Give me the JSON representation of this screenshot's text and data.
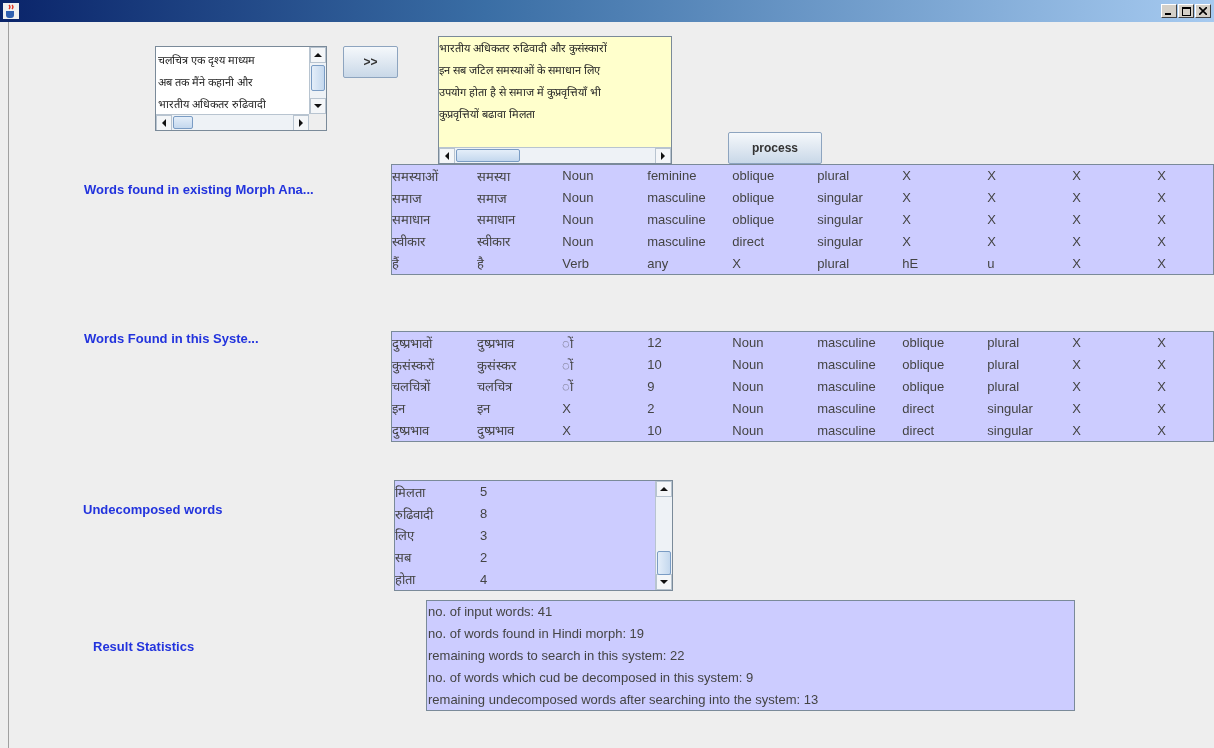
{
  "input_text": {
    "lines": [
      "चलचित्र एक दृश्य माध्यम",
      "अब तक मैंने कहानी और",
      "भारतीय अधिकतर रुढिवादी"
    ]
  },
  "transfer_button": ">>",
  "output_text": {
    "lines": [
      "भारतीय अधिकतर रुढिवादी और कुसंस्कारों",
      "इन सब जटिल समस्याओं के समाधान लिए",
      "उपयोग होता है से समाज में कुप्रवृत्तियाँ भी",
      "कुप्रवृत्तियों बढावा मिलता"
    ]
  },
  "process_button": "process",
  "tables": [
    {
      "label": "Words found in existing Morph Ana...",
      "rows": [
        [
          "समस्याओं",
          "समस्या",
          "Noun",
          "feminine",
          "oblique",
          "plural",
          "X",
          "X",
          "X",
          "X"
        ],
        [
          "समाज",
          "समाज",
          "Noun",
          "masculine",
          "oblique",
          "singular",
          "X",
          "X",
          "X",
          "X"
        ],
        [
          "समाधान",
          "समाधान",
          "Noun",
          "masculine",
          "oblique",
          "singular",
          "X",
          "X",
          "X",
          "X"
        ],
        [
          "स्वीकार",
          "स्वीकार",
          "Noun",
          "masculine",
          "direct",
          "singular",
          "X",
          "X",
          "X",
          "X"
        ],
        [
          "हैं",
          "है",
          "Verb",
          "any",
          "X",
          "plural",
          "hE",
          "u",
          "X",
          "X"
        ]
      ]
    },
    {
      "label": "Words Found in this Syste...",
      "rows": [
        [
          "दुष्प्रभावों",
          "दुष्प्रभाव",
          "ों",
          "12",
          "Noun",
          "masculine",
          "oblique",
          "plural",
          "X",
          "X"
        ],
        [
          "कुसंस्करों",
          "कुसंस्कर",
          "ों",
          "10",
          "Noun",
          "masculine",
          "oblique",
          "plural",
          "X",
          "X"
        ],
        [
          "चलचित्रों",
          "चलचित्र",
          "ों",
          "9",
          "Noun",
          "masculine",
          "oblique",
          "plural",
          "X",
          "X"
        ],
        [
          "इन",
          "इन",
          "X",
          "2",
          "Noun",
          "masculine",
          "direct",
          "singular",
          "X",
          "X"
        ],
        [
          "दुष्प्रभाव",
          "दुष्प्रभाव",
          "X",
          "10",
          "Noun",
          "masculine",
          "direct",
          "singular",
          "X",
          "X"
        ]
      ]
    },
    {
      "label": "Undecomposed words",
      "rows": [
        [
          "मिलता",
          "5"
        ],
        [
          "रुढिवादी",
          "8"
        ],
        [
          "लिए",
          "3"
        ],
        [
          "सब",
          "2"
        ],
        [
          "होता",
          "4"
        ]
      ]
    }
  ],
  "statistics": {
    "label": "Result Statistics",
    "lines": [
      "no. of input words: 41",
      "no. of words found in Hindi morph: 19",
      "remaining words to search in this system: 22",
      "no. of words which cud be decomposed in this system: 9",
      "remaining undecomposed words after searching into the system: 13"
    ]
  }
}
